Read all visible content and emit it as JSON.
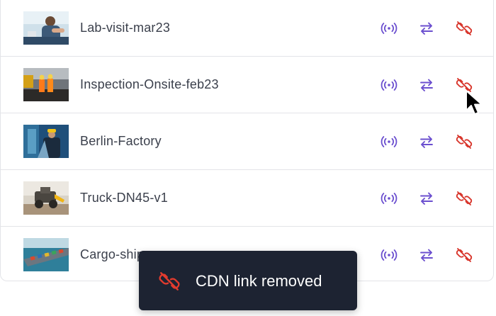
{
  "assets": [
    {
      "name": "Lab-visit-mar23",
      "thumb": "lab-photo"
    },
    {
      "name": "Inspection-Onsite-feb23",
      "thumb": "inspection-photo"
    },
    {
      "name": "Berlin-Factory",
      "thumb": "factory-photo"
    },
    {
      "name": "Truck-DN45-v1",
      "thumb": "truck-photo"
    },
    {
      "name": "Cargo-ship",
      "thumb": "cargo-ship-photo"
    }
  ],
  "actions": {
    "live": {
      "icon": "live-broadcast-icon",
      "color": "#6b4fcf"
    },
    "swap": {
      "icon": "swap-arrows-icon",
      "color": "#6b4fcf"
    },
    "unlink": {
      "icon": "unlink-icon",
      "color": "#d8362c"
    }
  },
  "toast": {
    "message": "CDN link removed",
    "icon": "unlink-icon",
    "icon_color": "#e23b2e",
    "background": "#1d2332"
  }
}
